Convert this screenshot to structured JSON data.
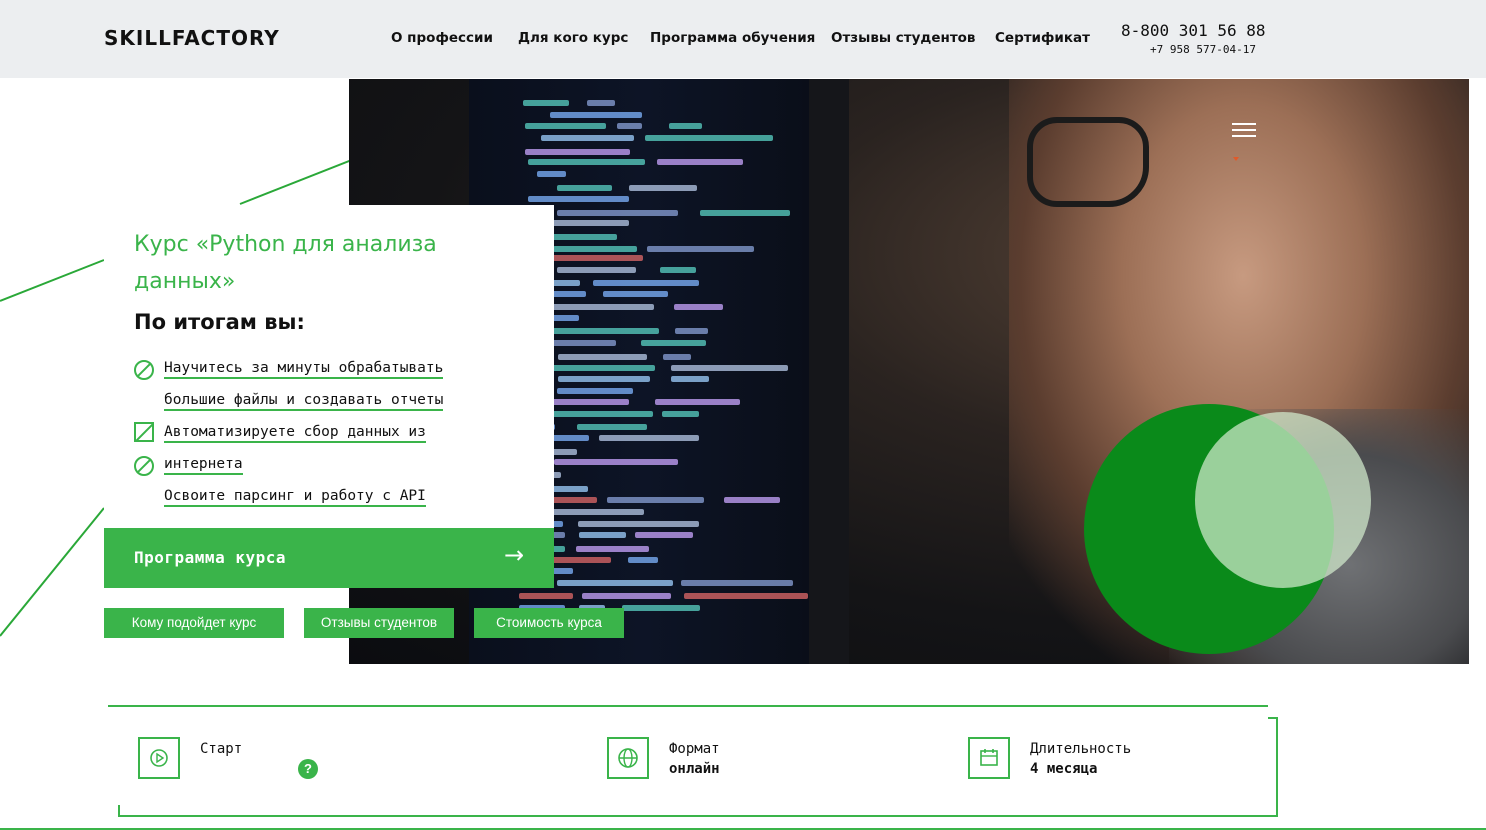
{
  "header": {
    "logo": "SKILLFACTORY",
    "nav": [
      {
        "label": "О профессии"
      },
      {
        "label": "Для кого курс"
      },
      {
        "label": "Программа обучения"
      },
      {
        "label": "Отзывы студентов"
      },
      {
        "label": "Сертификат"
      }
    ],
    "phone_main": "8-800 301 56 88",
    "phone_secondary": "+7 958 577-04-17"
  },
  "hero": {
    "course_title": "Курс «Python для анализа данных»",
    "results_heading": "По итогам вы:",
    "bullets": [
      {
        "text": "Научитесь за минуты обрабатывать",
        "icon": "ban-icon"
      },
      {
        "text": "большие файлы и создавать отчеты"
      },
      {
        "text": "Автоматизируете сбор данных из",
        "icon": "checkbox-slash-icon"
      },
      {
        "text": "интернета",
        "icon": "ban-icon"
      },
      {
        "text": "Освоите парсинг и работу с API"
      }
    ],
    "program_button": "Программа курса",
    "program_arrow": "→",
    "secondary_buttons": [
      {
        "label": "Кому подойдет курс"
      },
      {
        "label": "Отзывы студентов"
      },
      {
        "label": "Стоимость курса"
      }
    ]
  },
  "info": {
    "start": {
      "label": "Старт",
      "help": "?"
    },
    "format": {
      "label": "Формат",
      "value": "онлайн"
    },
    "duration": {
      "label": "Длительность",
      "value": "4 месяца"
    }
  },
  "colors": {
    "accent": "#3ab44a",
    "header_bg": "#eceef0",
    "circle_green": "#0a8a1a"
  }
}
